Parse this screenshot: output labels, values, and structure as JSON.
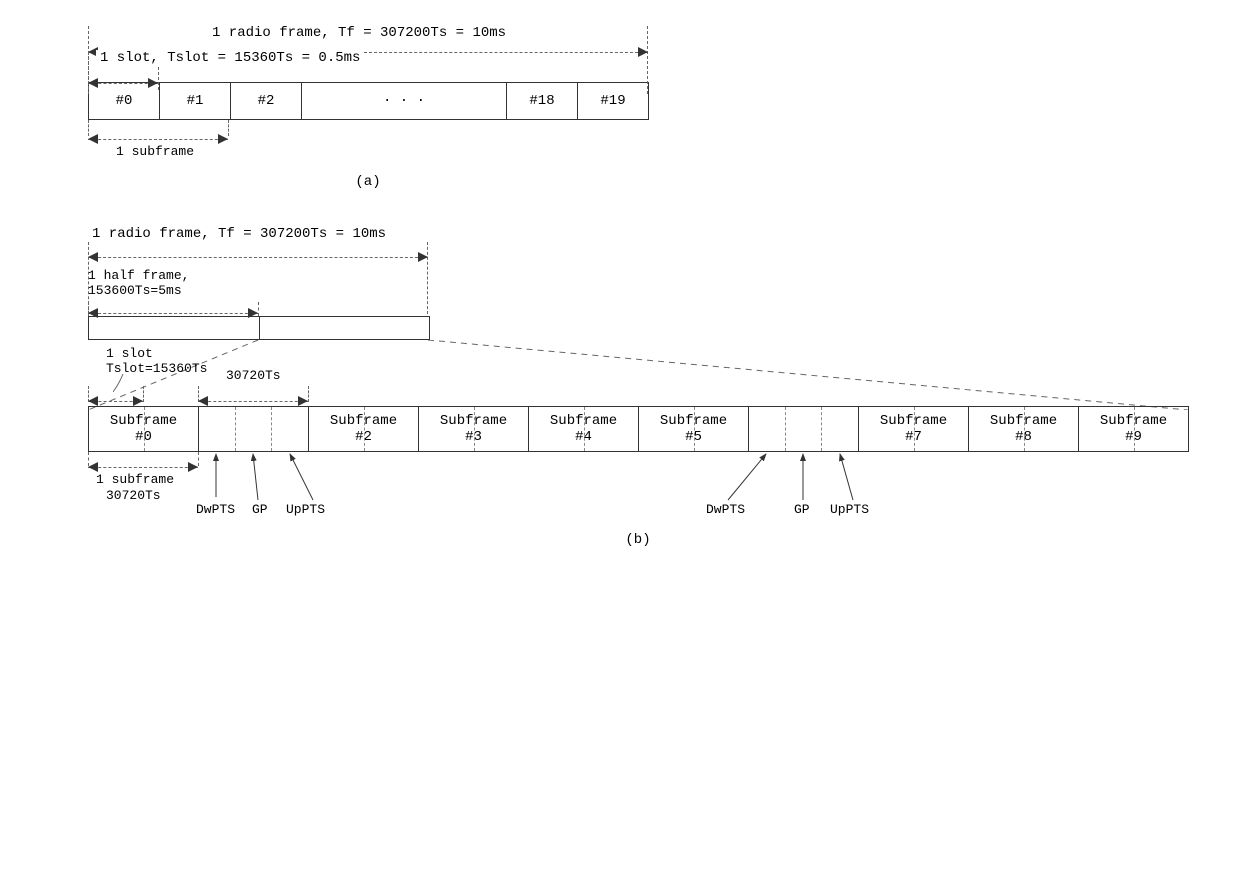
{
  "panel_a": {
    "radio_frame_label": "1 radio frame, Tf = 307200Ts = 10ms",
    "slot_label": "1 slot, Tslot = 15360Ts = 0.5ms",
    "subframe_label": "1 subframe",
    "panel_tag": "(a)",
    "slots": [
      "#0",
      "#1",
      "#2",
      "· · ·",
      "#18",
      "#19"
    ]
  },
  "panel_b": {
    "radio_frame_label": "1 radio frame, Tf = 307200Ts = 10ms",
    "half_frame_label_1": "1 half frame,",
    "half_frame_label_2": "153600Ts=5ms",
    "slot_label_1": "1 slot",
    "slot_label_2": "Tslot=15360Ts",
    "subframe_duration": "30720Ts",
    "subframe_below_1": "1 subframe",
    "subframe_below_2": "30720Ts",
    "panel_tag": "(b)",
    "subframes": [
      {
        "label1": "Subframe",
        "label2": "#0",
        "type": "normal"
      },
      {
        "label1": "",
        "label2": "",
        "type": "special"
      },
      {
        "label1": "Subframe",
        "label2": "#2",
        "type": "normal"
      },
      {
        "label1": "Subframe",
        "label2": "#3",
        "type": "normal"
      },
      {
        "label1": "Subframe",
        "label2": "#4",
        "type": "normal"
      },
      {
        "label1": "Subframe",
        "label2": "#5",
        "type": "normal"
      },
      {
        "label1": "",
        "label2": "",
        "type": "special"
      },
      {
        "label1": "Subframe",
        "label2": "#7",
        "type": "normal"
      },
      {
        "label1": "Subframe",
        "label2": "#8",
        "type": "normal"
      },
      {
        "label1": "Subframe",
        "label2": "#9",
        "type": "normal"
      }
    ],
    "special_parts": {
      "dwpts": "DwPTS",
      "gp": "GP",
      "uppts": "UpPTS"
    }
  }
}
